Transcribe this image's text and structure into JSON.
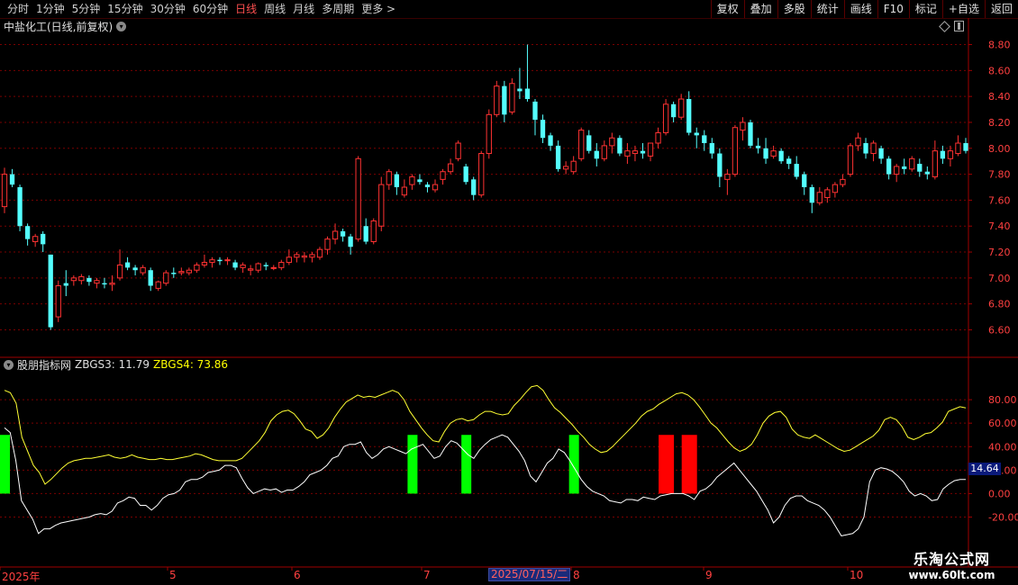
{
  "toolbar": {
    "periods": [
      "分时",
      "1分钟",
      "5分钟",
      "15分钟",
      "30分钟",
      "60分钟",
      "日线",
      "周线",
      "月线",
      "多周期",
      "更多 >"
    ],
    "active_index": 6,
    "right_buttons": [
      "复权",
      "叠加",
      "多股",
      "统计",
      "画线",
      "F10",
      "标记",
      "+自选",
      "返回"
    ]
  },
  "stock": {
    "title": "中盐化工(日线,前复权)"
  },
  "indicator": {
    "name": "股朋指标网",
    "zbgs3": "ZBGS3: 11.79",
    "zbgs4": "ZBGS4: 73.86",
    "cursor_value": "14.64"
  },
  "xaxis": {
    "labels": [
      "2025年",
      "5",
      "6",
      "7",
      "8",
      "9",
      "10"
    ],
    "cursor_date": "2025/07/15/二"
  },
  "watermark": {
    "line1": "乐淘公式网",
    "line2": "www.60lt.com"
  },
  "colors": {
    "up": "#ff3232",
    "down": "#54ffff",
    "zbgs3": "#ffffff",
    "zbgs4": "#ffff33",
    "green_bar": "#00ff00",
    "red_bar": "#ff0000",
    "grid": "#7a0000"
  },
  "chart_data": [
    {
      "type": "candlestick",
      "title": "中盐化工(日线,前复权)",
      "y_ticks": [
        "8.80",
        "8.60",
        "8.40",
        "8.20",
        "8.00",
        "7.80",
        "7.60",
        "7.40",
        "7.20",
        "7.00",
        "6.80",
        "6.60"
      ],
      "ylim": [
        6.52,
        8.88
      ],
      "candles": [
        [
          7.55,
          7.85,
          7.5,
          7.8
        ],
        [
          7.8,
          7.84,
          7.7,
          7.72
        ],
        [
          7.7,
          7.72,
          7.36,
          7.4
        ],
        [
          7.4,
          7.42,
          7.25,
          7.3
        ],
        [
          7.28,
          7.34,
          7.24,
          7.32
        ],
        [
          7.34,
          7.36,
          7.2,
          7.26
        ],
        [
          7.18,
          7.18,
          6.6,
          6.62
        ],
        [
          6.7,
          6.98,
          6.66,
          6.94
        ],
        [
          6.96,
          7.06,
          6.86,
          6.94
        ],
        [
          6.98,
          7.02,
          6.94,
          7.0
        ],
        [
          6.98,
          7.03,
          6.95,
          7.01
        ],
        [
          7.0,
          7.02,
          6.94,
          6.97
        ],
        [
          6.96,
          7.0,
          6.92,
          6.98
        ],
        [
          6.96,
          7.0,
          6.92,
          6.95
        ],
        [
          6.95,
          7.02,
          6.9,
          6.96
        ],
        [
          7.0,
          7.22,
          6.98,
          7.1
        ],
        [
          7.12,
          7.16,
          7.06,
          7.08
        ],
        [
          7.08,
          7.1,
          7.02,
          7.06
        ],
        [
          7.04,
          7.1,
          7.02,
          7.08
        ],
        [
          7.06,
          7.08,
          6.9,
          6.94
        ],
        [
          6.92,
          6.98,
          6.9,
          6.97
        ],
        [
          6.96,
          7.06,
          6.94,
          7.04
        ],
        [
          7.04,
          7.08,
          7.0,
          7.03
        ],
        [
          7.04,
          7.08,
          7.02,
          7.05
        ],
        [
          7.04,
          7.08,
          7.02,
          7.06
        ],
        [
          7.06,
          7.12,
          7.04,
          7.1
        ],
        [
          7.1,
          7.18,
          7.08,
          7.12
        ],
        [
          7.12,
          7.16,
          7.08,
          7.14
        ],
        [
          7.14,
          7.16,
          7.1,
          7.13
        ],
        [
          7.14,
          7.16,
          7.1,
          7.14
        ],
        [
          7.12,
          7.14,
          7.06,
          7.08
        ],
        [
          7.08,
          7.12,
          7.04,
          7.1
        ],
        [
          7.06,
          7.1,
          7.02,
          7.07
        ],
        [
          7.06,
          7.12,
          7.04,
          7.11
        ],
        [
          7.1,
          7.12,
          7.06,
          7.09
        ],
        [
          7.08,
          7.1,
          7.06,
          7.08
        ],
        [
          7.08,
          7.14,
          7.06,
          7.12
        ],
        [
          7.12,
          7.22,
          7.1,
          7.16
        ],
        [
          7.16,
          7.2,
          7.12,
          7.18
        ],
        [
          7.16,
          7.2,
          7.12,
          7.17
        ],
        [
          7.16,
          7.2,
          7.12,
          7.18
        ],
        [
          7.16,
          7.24,
          7.14,
          7.22
        ],
        [
          7.22,
          7.32,
          7.18,
          7.3
        ],
        [
          7.3,
          7.42,
          7.26,
          7.36
        ],
        [
          7.36,
          7.38,
          7.28,
          7.32
        ],
        [
          7.32,
          7.34,
          7.18,
          7.24
        ],
        [
          7.3,
          7.94,
          7.28,
          7.92
        ],
        [
          7.4,
          7.46,
          7.26,
          7.28
        ],
        [
          7.28,
          7.46,
          7.26,
          7.44
        ],
        [
          7.4,
          7.78,
          7.36,
          7.72
        ],
        [
          7.72,
          7.84,
          7.68,
          7.82
        ],
        [
          7.8,
          7.82,
          7.64,
          7.7
        ],
        [
          7.64,
          7.76,
          7.62,
          7.7
        ],
        [
          7.72,
          7.8,
          7.68,
          7.78
        ],
        [
          7.76,
          7.8,
          7.72,
          7.74
        ],
        [
          7.72,
          7.74,
          7.66,
          7.7
        ],
        [
          7.68,
          7.76,
          7.66,
          7.72
        ],
        [
          7.76,
          7.84,
          7.72,
          7.82
        ],
        [
          7.82,
          7.92,
          7.8,
          7.88
        ],
        [
          7.92,
          8.06,
          7.9,
          8.04
        ],
        [
          7.86,
          7.88,
          7.72,
          7.74
        ],
        [
          7.76,
          7.78,
          7.6,
          7.64
        ],
        [
          7.64,
          7.98,
          7.62,
          7.96
        ],
        [
          7.96,
          8.3,
          7.92,
          8.26
        ],
        [
          8.26,
          8.52,
          8.24,
          8.48
        ],
        [
          8.48,
          8.52,
          8.2,
          8.26
        ],
        [
          8.28,
          8.54,
          8.26,
          8.5
        ],
        [
          8.46,
          8.62,
          8.38,
          8.44
        ],
        [
          8.46,
          8.8,
          8.36,
          8.38
        ],
        [
          8.36,
          8.38,
          8.1,
          8.22
        ],
        [
          8.22,
          8.26,
          8.04,
          8.08
        ],
        [
          8.1,
          8.12,
          7.98,
          8.02
        ],
        [
          8.02,
          8.06,
          7.82,
          7.84
        ],
        [
          7.84,
          7.9,
          7.8,
          7.86
        ],
        [
          7.82,
          7.94,
          7.8,
          7.9
        ],
        [
          7.92,
          8.16,
          7.9,
          8.14
        ],
        [
          8.1,
          8.14,
          7.96,
          7.98
        ],
        [
          7.98,
          8.04,
          7.86,
          7.92
        ],
        [
          7.92,
          8.06,
          7.9,
          8.02
        ],
        [
          8.02,
          8.12,
          7.96,
          8.08
        ],
        [
          8.08,
          8.1,
          7.94,
          7.96
        ],
        [
          7.94,
          8.04,
          7.88,
          7.98
        ],
        [
          7.96,
          8.02,
          7.9,
          7.98
        ],
        [
          7.98,
          8.04,
          7.92,
          7.96
        ],
        [
          7.94,
          8.0,
          7.9,
          8.04
        ],
        [
          8.04,
          8.16,
          8.0,
          8.12
        ],
        [
          8.12,
          8.38,
          8.1,
          8.34
        ],
        [
          8.34,
          8.36,
          8.2,
          8.24
        ],
        [
          8.24,
          8.42,
          8.22,
          8.38
        ],
        [
          8.38,
          8.44,
          8.1,
          8.12
        ],
        [
          8.12,
          8.16,
          8.0,
          8.1
        ],
        [
          8.1,
          8.14,
          7.98,
          8.04
        ],
        [
          8.04,
          8.08,
          7.92,
          7.96
        ],
        [
          7.96,
          8.0,
          7.7,
          7.78
        ],
        [
          7.76,
          7.84,
          7.64,
          7.8
        ],
        [
          7.8,
          8.18,
          7.78,
          8.16
        ],
        [
          8.14,
          8.24,
          8.06,
          8.2
        ],
        [
          8.2,
          8.22,
          8.0,
          8.02
        ],
        [
          8.02,
          8.08,
          7.96,
          8.0
        ],
        [
          8.0,
          8.08,
          7.88,
          7.92
        ],
        [
          7.94,
          8.02,
          7.92,
          7.98
        ],
        [
          7.98,
          8.0,
          7.88,
          7.9
        ],
        [
          7.92,
          7.94,
          7.84,
          7.88
        ],
        [
          7.88,
          7.94,
          7.76,
          7.78
        ],
        [
          7.8,
          7.82,
          7.64,
          7.7
        ],
        [
          7.7,
          7.72,
          7.5,
          7.58
        ],
        [
          7.58,
          7.7,
          7.56,
          7.66
        ],
        [
          7.62,
          7.7,
          7.58,
          7.68
        ],
        [
          7.66,
          7.74,
          7.62,
          7.72
        ],
        [
          7.72,
          7.8,
          7.7,
          7.76
        ],
        [
          7.8,
          8.04,
          7.78,
          8.02
        ],
        [
          8.02,
          8.12,
          7.98,
          8.08
        ],
        [
          8.04,
          8.08,
          7.92,
          7.96
        ],
        [
          7.96,
          8.06,
          7.9,
          8.04
        ],
        [
          8.0,
          8.02,
          7.88,
          7.92
        ],
        [
          7.92,
          7.94,
          7.76,
          7.8
        ],
        [
          7.8,
          7.88,
          7.74,
          7.86
        ],
        [
          7.86,
          7.92,
          7.8,
          7.84
        ],
        [
          7.84,
          7.94,
          7.82,
          7.92
        ],
        [
          7.88,
          7.92,
          7.78,
          7.82
        ],
        [
          7.82,
          7.86,
          7.76,
          7.8
        ],
        [
          7.78,
          8.06,
          7.76,
          7.98
        ],
        [
          7.98,
          8.02,
          7.88,
          7.92
        ],
        [
          7.92,
          8.02,
          7.86,
          7.98
        ],
        [
          7.96,
          8.1,
          7.94,
          8.04
        ],
        [
          8.04,
          8.08,
          7.96,
          7.98
        ]
      ]
    },
    {
      "type": "line",
      "title": "股朋指标网",
      "y_ticks": [
        "80.00",
        "60.00",
        "40.00",
        "20.00",
        "0.00",
        "-20.00"
      ],
      "ylim": [
        -38,
        100
      ],
      "series": [
        {
          "name": "ZBGS4",
          "values": [
            88,
            86,
            77,
            48,
            36,
            24,
            18,
            8,
            12,
            17,
            22,
            26,
            28,
            29,
            30,
            30,
            31,
            32,
            33,
            31,
            30,
            31,
            33,
            31,
            30,
            29,
            29,
            30,
            29,
            29,
            30,
            31,
            32,
            34,
            33,
            31,
            29,
            28,
            28,
            28,
            28,
            30,
            35,
            40,
            45,
            52,
            62,
            67,
            70,
            71,
            68,
            62,
            55,
            53,
            47,
            50,
            56,
            65,
            72,
            78,
            81,
            84,
            82,
            83,
            82,
            84,
            86,
            88,
            86,
            80,
            70,
            63,
            56,
            50,
            45,
            44,
            53,
            60,
            63,
            64,
            62,
            63,
            67,
            70,
            70,
            68,
            67,
            68,
            75,
            80,
            86,
            91,
            92,
            88,
            80,
            73,
            69,
            64,
            59,
            53,
            48,
            42,
            38,
            35,
            36,
            40,
            45,
            50,
            55,
            60,
            66,
            70,
            72,
            76,
            79,
            82,
            85,
            86,
            84,
            80,
            74,
            67,
            60,
            56,
            50,
            44,
            39,
            36,
            38,
            42,
            50,
            60,
            66,
            69,
            70,
            65,
            55,
            50,
            48,
            47,
            50,
            47,
            44,
            41,
            38,
            36,
            37,
            40,
            43,
            46,
            49,
            54,
            63,
            65,
            63,
            57,
            48,
            46,
            48,
            51,
            52,
            56,
            61,
            70,
            72,
            74,
            73
          ]
        },
        {
          "name": "ZBGS3",
          "values": [
            56,
            52,
            28,
            -6,
            -14,
            -22,
            -34,
            -30,
            -30,
            -27,
            -25,
            -24,
            -23,
            -22,
            -21,
            -20,
            -18,
            -17,
            -18,
            -15,
            -8,
            -6,
            -3,
            -4,
            -10,
            -10,
            -14,
            -10,
            -4,
            -1,
            0,
            3,
            10,
            12,
            12,
            14,
            18,
            19,
            20,
            24,
            24,
            22,
            13,
            5,
            0,
            2,
            4,
            3,
            4,
            1,
            3,
            3,
            6,
            10,
            16,
            18,
            20,
            24,
            30,
            32,
            40,
            42,
            42,
            44,
            35,
            30,
            33,
            38,
            40,
            38,
            36,
            34,
            38,
            40,
            42,
            36,
            30,
            32,
            40,
            45,
            43,
            38,
            33,
            30,
            37,
            42,
            46,
            48,
            50,
            48,
            42,
            36,
            28,
            15,
            10,
            18,
            26,
            30,
            38,
            35,
            28,
            20,
            12,
            6,
            2,
            0,
            -2,
            -6,
            -7,
            -8,
            -5,
            -5,
            -6,
            -3,
            -4,
            -5,
            -2,
            -1,
            0,
            0,
            0,
            -2,
            -5,
            2,
            4,
            8,
            14,
            18,
            22,
            26,
            20,
            14,
            8,
            2,
            -6,
            -14,
            -25,
            -20,
            -10,
            -4,
            -2,
            -2,
            -6,
            -8,
            -10,
            -14,
            -20,
            -28,
            -36,
            -35,
            -34,
            -30,
            -20,
            10,
            20,
            22,
            21,
            19,
            15,
            10,
            2,
            -2,
            0,
            -2,
            -6,
            -5,
            4,
            8,
            11,
            12,
            12
          ]
        }
      ],
      "green_bars_at": [
        0,
        53,
        60,
        74
      ],
      "red_bars_at": [
        86,
        89
      ]
    }
  ]
}
